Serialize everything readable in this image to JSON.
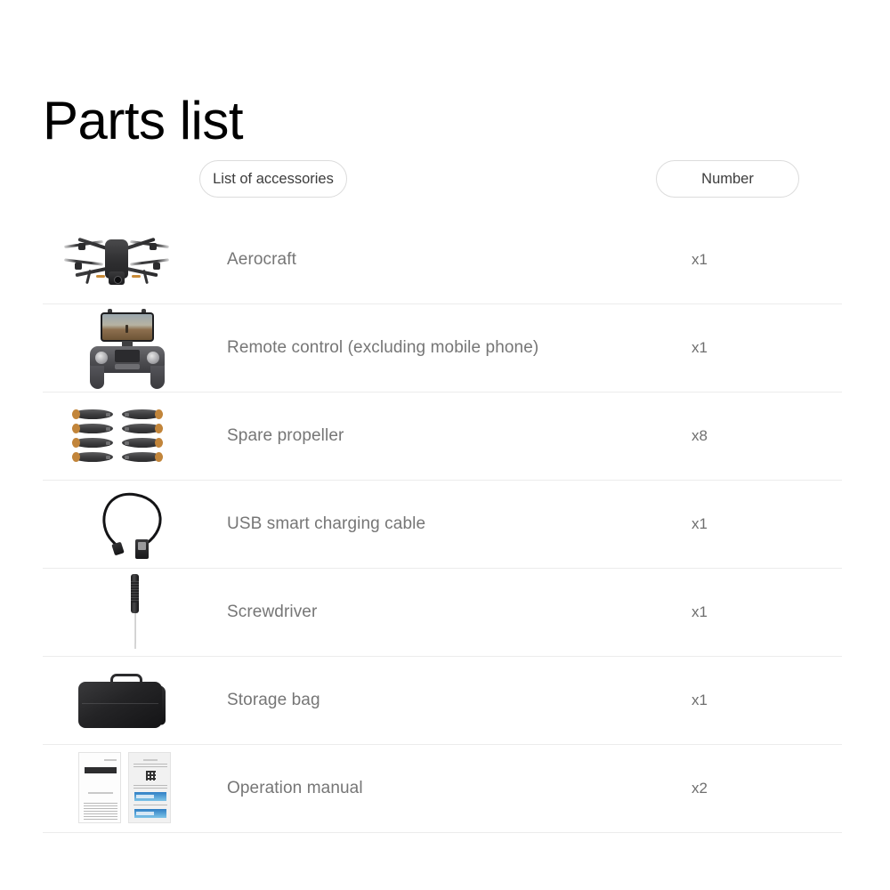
{
  "page": {
    "title": "Parts list"
  },
  "header": {
    "accessories_label": "List of accessories",
    "number_label": "Number"
  },
  "rows": [
    {
      "thumb": "drone-image",
      "label": "Aerocraft",
      "qty": "x1"
    },
    {
      "thumb": "remote-control-image",
      "label": "Remote control (excluding mobile phone)",
      "qty": "x1"
    },
    {
      "thumb": "propellers-image",
      "label": "Spare propeller",
      "qty": "x8"
    },
    {
      "thumb": "usb-cable-image",
      "label": "USB smart charging cable",
      "qty": "x1"
    },
    {
      "thumb": "screwdriver-image",
      "label": "Screwdriver",
      "qty": "x1"
    },
    {
      "thumb": "storage-bag-image",
      "label": "Storage bag",
      "qty": "x1"
    },
    {
      "thumb": "operation-manual-image",
      "label": "Operation manual",
      "qty": "x2"
    }
  ],
  "colors": {
    "background": "#ffffff",
    "title_text": "#000000",
    "row_text": "#767676",
    "qty_text": "#6f6f6f",
    "pill_border": "#dcdcdc",
    "pill_text": "#3c3c3c",
    "divider": "#ececec",
    "propeller_tip": "#c2853a"
  }
}
